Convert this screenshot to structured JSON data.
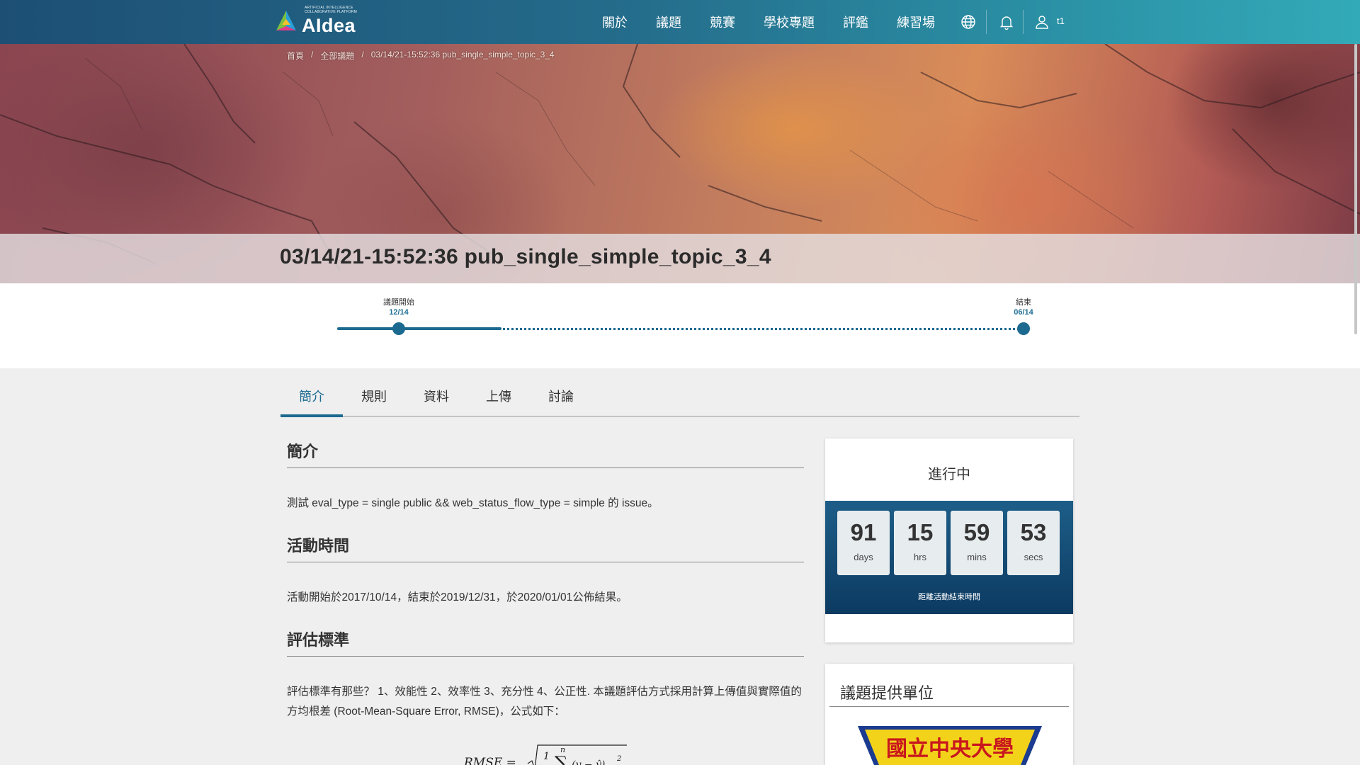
{
  "app": {
    "logo_text": "AIdea",
    "logo_subtitle": "ARTIFICIAL INTELLIGENCE\nCOLLABORATIVE PLATFORM"
  },
  "nav": {
    "items": [
      {
        "label": "關於"
      },
      {
        "label": "議題"
      },
      {
        "label": "競賽"
      },
      {
        "label": "學校專題"
      },
      {
        "label": "評鑑"
      },
      {
        "label": "練習場"
      }
    ],
    "user": "t1"
  },
  "breadcrumb": [
    "首頁",
    "/",
    "全部議題",
    "/",
    "03/14/21-15:52:36 pub_single_simple_topic_3_4"
  ],
  "page_title": "03/14/21-15:52:36 pub_single_simple_topic_3_4",
  "timeline": {
    "start_label": "議題開始",
    "start_date": "12/14",
    "end_label": "結束",
    "end_date": "06/14"
  },
  "tabs": [
    {
      "label": "簡介",
      "active": true
    },
    {
      "label": "規則",
      "active": false
    },
    {
      "label": "資料",
      "active": false
    },
    {
      "label": "上傳",
      "active": false
    },
    {
      "label": "討論",
      "active": false
    }
  ],
  "content": {
    "sections": [
      {
        "heading": "簡介",
        "text": "測試 eval_type = single public && web_status_flow_type = simple 的 issue。"
      },
      {
        "heading": "活動時間",
        "text": "活動開始於2017/10/14，結束於2019/12/31，於2020/01/01公佈結果。"
      },
      {
        "heading": "評估標準",
        "text": "評估標準有那些？ 1、效能性 2、效率性 3、充分性 4、公正性. 本議題評估方式採用計算上傳值與實際值的方均根差 (Root-Mean-Square Error, RMSE)，公式如下："
      }
    ],
    "formula_label": "RMSE ="
  },
  "status": {
    "title": "進行中",
    "countdown": [
      {
        "value": "91",
        "unit": "days"
      },
      {
        "value": "15",
        "unit": "hrs"
      },
      {
        "value": "59",
        "unit": "mins"
      },
      {
        "value": "53",
        "unit": "secs"
      }
    ],
    "caption": "距離活動結束時間"
  },
  "provider": {
    "title": "議題提供單位",
    "logo_text": "國立中央大學"
  },
  "colors": {
    "accent": "#1d6a91",
    "nav_start": "#1d4f74",
    "nav_end": "#33aab8",
    "countdown_bg": "#0c3a61"
  }
}
